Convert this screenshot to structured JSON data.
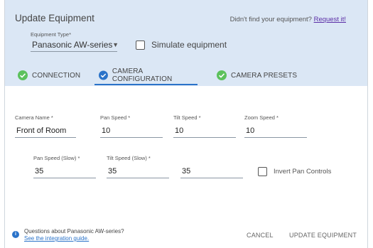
{
  "header": {
    "title": "Update Equipment",
    "not_found_text": "Didn't find your equipment?",
    "request_link": "Request it!",
    "equipment_type_label": "Equipment Type*",
    "equipment_type_value": "Panasonic AW-series",
    "simulate_label": "Simulate equipment"
  },
  "tabs": [
    {
      "label": "CONNECTION",
      "status": "complete"
    },
    {
      "label": "CAMERA CONFIGURATION",
      "status": "complete",
      "active": true
    },
    {
      "label": "CAMERA PRESETS",
      "status": "complete"
    }
  ],
  "form": {
    "camera_name": {
      "label": "Camera Name *",
      "value": "Front of Room"
    },
    "pan_speed": {
      "label": "Pan Speed *",
      "value": "10"
    },
    "tilt_speed": {
      "label": "Tilt Speed *",
      "value": "10"
    },
    "zoom_speed": {
      "label": "Zoom Speed *",
      "value": "10"
    },
    "pan_speed_slow": {
      "label": "Pan Speed (Slow) *",
      "value": "35"
    },
    "tilt_speed_slow": {
      "label": "Tilt Speed (Slow) *",
      "value": "35"
    },
    "third_slow": {
      "value": "35"
    },
    "invert_label": "Invert Pan Controls"
  },
  "footer": {
    "question": "Questions about Panasonic AW-series?",
    "guide_link": "See the integration guide.",
    "cancel": "CANCEL",
    "update": "UPDATE EQUIPMENT"
  },
  "colors": {
    "header_bg": "#dbe7f5",
    "accent": "#2b73c9",
    "success": "#5cc15c",
    "link": "#5b2ea6"
  }
}
